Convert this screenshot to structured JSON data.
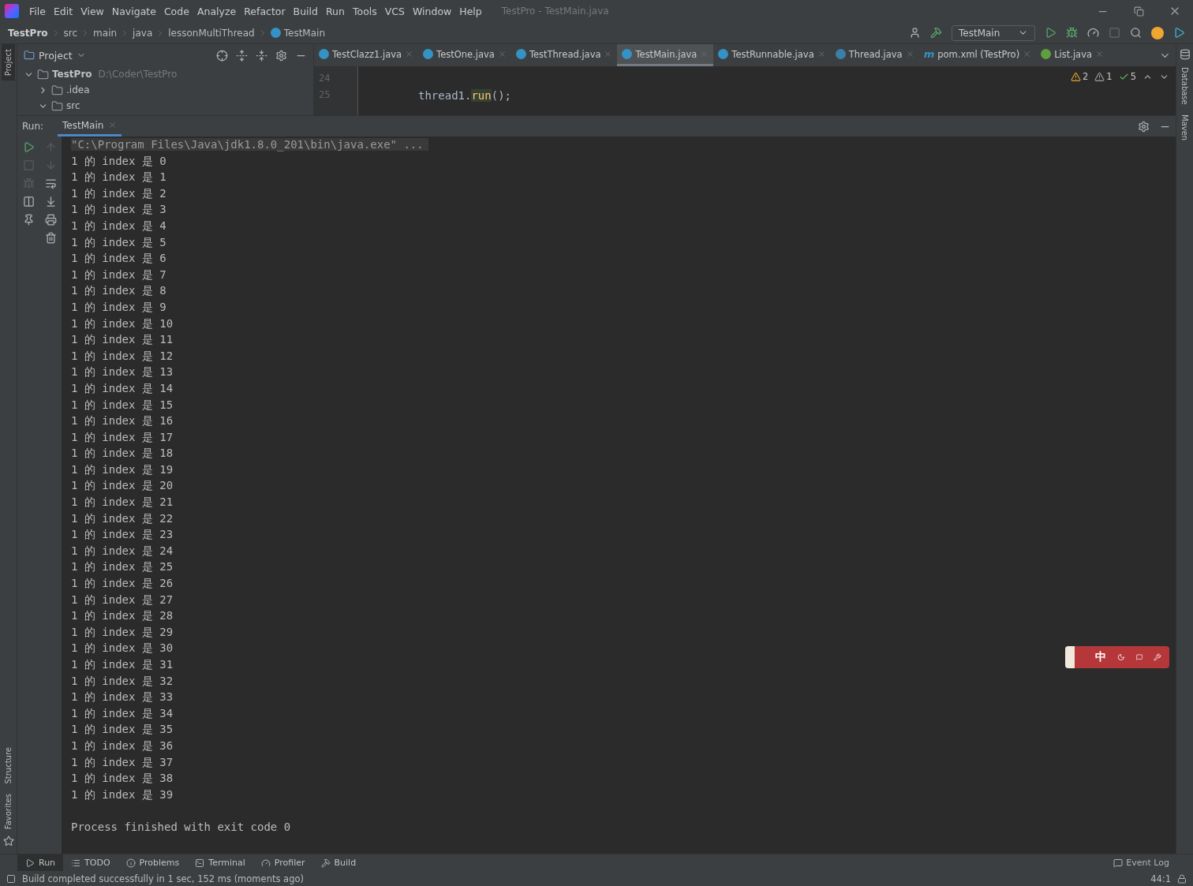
{
  "menu": [
    "File",
    "Edit",
    "View",
    "Navigate",
    "Code",
    "Analyze",
    "Refactor",
    "Build",
    "Run",
    "Tools",
    "VCS",
    "Window",
    "Help"
  ],
  "window": {
    "title": "TestPro - TestMain.java"
  },
  "breadcrumbs": [
    "TestPro",
    "src",
    "main",
    "java",
    "lessonMultiThread",
    "TestMain"
  ],
  "run_config": "TestMain",
  "left_stripe": [
    {
      "label": "Project",
      "selected": true
    },
    {
      "label": "Structure",
      "selected": false
    },
    {
      "label": "Favorites",
      "selected": false
    }
  ],
  "right_stripe": [
    "Database",
    "Maven"
  ],
  "project_panel": {
    "title": "Project",
    "tree": [
      {
        "label": "TestPro",
        "path": "D:\\Coder\\TestPro",
        "expanded": true,
        "children": [
          {
            "label": ".idea",
            "expanded": false
          },
          {
            "label": "src",
            "expanded": true
          }
        ]
      }
    ]
  },
  "editor_tabs": [
    {
      "label": "TestClazz1.java",
      "kind": "class",
      "selected": false
    },
    {
      "label": "TestOne.java",
      "kind": "class",
      "selected": false
    },
    {
      "label": "TestThread.java",
      "kind": "class",
      "selected": false
    },
    {
      "label": "TestMain.java",
      "kind": "class",
      "selected": true
    },
    {
      "label": "TestRunnable.java",
      "kind": "class",
      "selected": false
    },
    {
      "label": "Thread.java",
      "kind": "library",
      "selected": false
    },
    {
      "label": "pom.xml (TestPro)",
      "kind": "maven",
      "icon_glyph": "m",
      "selected": false
    },
    {
      "label": "List.java",
      "kind": "interface",
      "selected": false
    }
  ],
  "inspections": [
    {
      "kind": "warning",
      "count": "2"
    },
    {
      "kind": "weak",
      "count": "1"
    },
    {
      "kind": "typo",
      "count": "5"
    }
  ],
  "editor": {
    "lines": [
      {
        "number": "24"
      },
      {
        "number": "25",
        "parts": [
          {
            "text": "thread1.",
            "highlighted": false
          },
          {
            "text": "run",
            "highlighted": true
          },
          {
            "text": "();",
            "highlighted": false
          }
        ]
      }
    ]
  },
  "run_panel": {
    "label": "Run:",
    "tab": "TestMain",
    "command": "\"C:\\Program Files\\Java\\jdk1.8.0_201\\bin\\java.exe\" ...",
    "output": [
      "1 的 index 是 0",
      "1 的 index 是 1",
      "1 的 index 是 2",
      "1 的 index 是 3",
      "1 的 index 是 4",
      "1 的 index 是 5",
      "1 的 index 是 6",
      "1 的 index 是 7",
      "1 的 index 是 8",
      "1 的 index 是 9",
      "1 的 index 是 10",
      "1 的 index 是 11",
      "1 的 index 是 12",
      "1 的 index 是 13",
      "1 的 index 是 14",
      "1 的 index 是 15",
      "1 的 index 是 16",
      "1 的 index 是 17",
      "1 的 index 是 18",
      "1 的 index 是 19",
      "1 的 index 是 20",
      "1 的 index 是 21",
      "1 的 index 是 22",
      "1 的 index 是 23",
      "1 的 index 是 24",
      "1 的 index 是 25",
      "1 的 index 是 26",
      "1 的 index 是 27",
      "1 的 index 是 28",
      "1 的 index 是 29",
      "1 的 index 是 30",
      "1 的 index 是 31",
      "1 的 index 是 32",
      "1 的 index 是 33",
      "1 的 index 是 34",
      "1 的 index 是 35",
      "1 的 index 是 36",
      "1 的 index 是 37",
      "1 的 index 是 38",
      "1 的 index 是 39"
    ],
    "exit_message": "Process finished with exit code 0"
  },
  "ime_toolbar": {
    "mode": "中"
  },
  "bottom_tools": [
    {
      "label": "Run",
      "kind": "run",
      "selected": true
    },
    {
      "label": "TODO",
      "kind": "todo",
      "selected": false
    },
    {
      "label": "Problems",
      "kind": "problems",
      "selected": false
    },
    {
      "label": "Terminal",
      "kind": "terminal",
      "selected": false
    },
    {
      "label": "Profiler",
      "kind": "profiler",
      "selected": false
    },
    {
      "label": "Build",
      "kind": "build",
      "selected": false
    }
  ],
  "event_log": "Event Log",
  "status_bar": {
    "message": "Build completed successfully in 1 sec, 152 ms (moments ago)",
    "position": "44:1"
  }
}
